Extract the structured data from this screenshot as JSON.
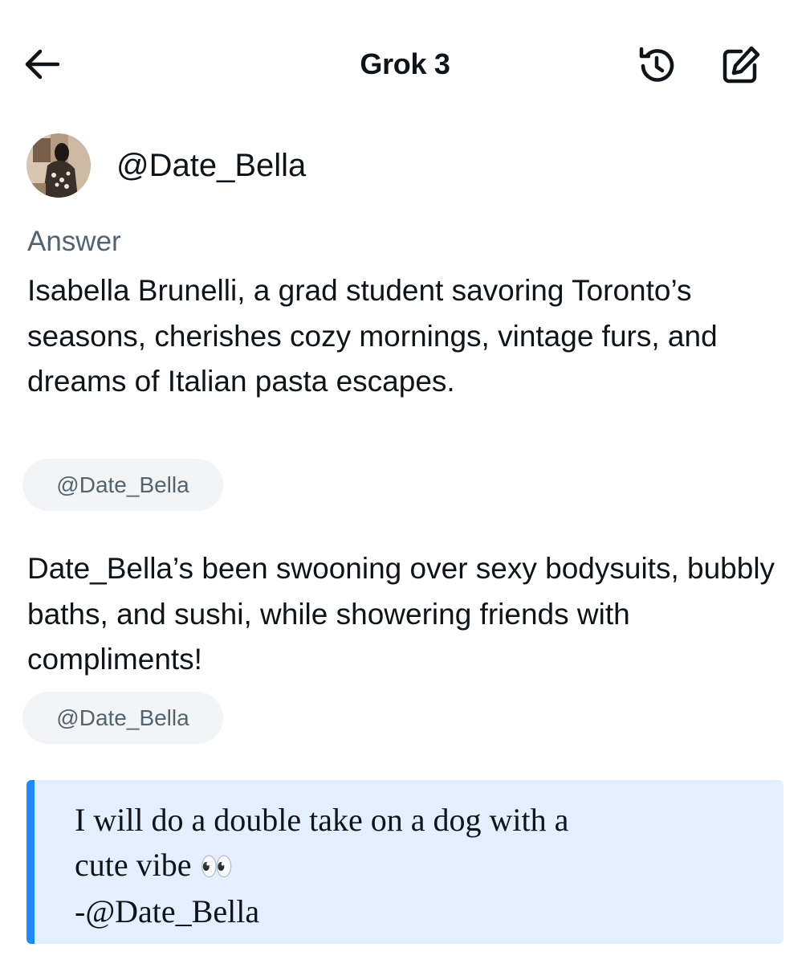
{
  "header": {
    "title": "Grok 3",
    "back_icon": "arrow-left-icon",
    "history_icon": "history-icon",
    "compose_icon": "compose-icon"
  },
  "profile": {
    "handle": "@Date_Bella"
  },
  "answer": {
    "label": "Answer",
    "paragraph1": "Isabella Brunelli, a grad student savoring Toronto’s seasons, cherishes cozy mornings, vintage furs, and dreams of Italian pasta escapes.",
    "source1": "@Date_Bella",
    "paragraph2": "Date_Bella’s been swooning over sexy bodysuits, bubbly baths, and sushi, while showering friends with compliments!",
    "source2": "@Date_Bella"
  },
  "quote": {
    "line1": "I will do a double take on a dog with a",
    "line2": "cute vibe",
    "line2_emoji": "👀",
    "attribution": "-@Date_Bella"
  },
  "colors": {
    "text": "#0f1419",
    "muted": "#536471",
    "chip_bg": "#f3f4f5",
    "quote_bg": "#e3efff",
    "quote_accent": "#1d8bf7"
  }
}
